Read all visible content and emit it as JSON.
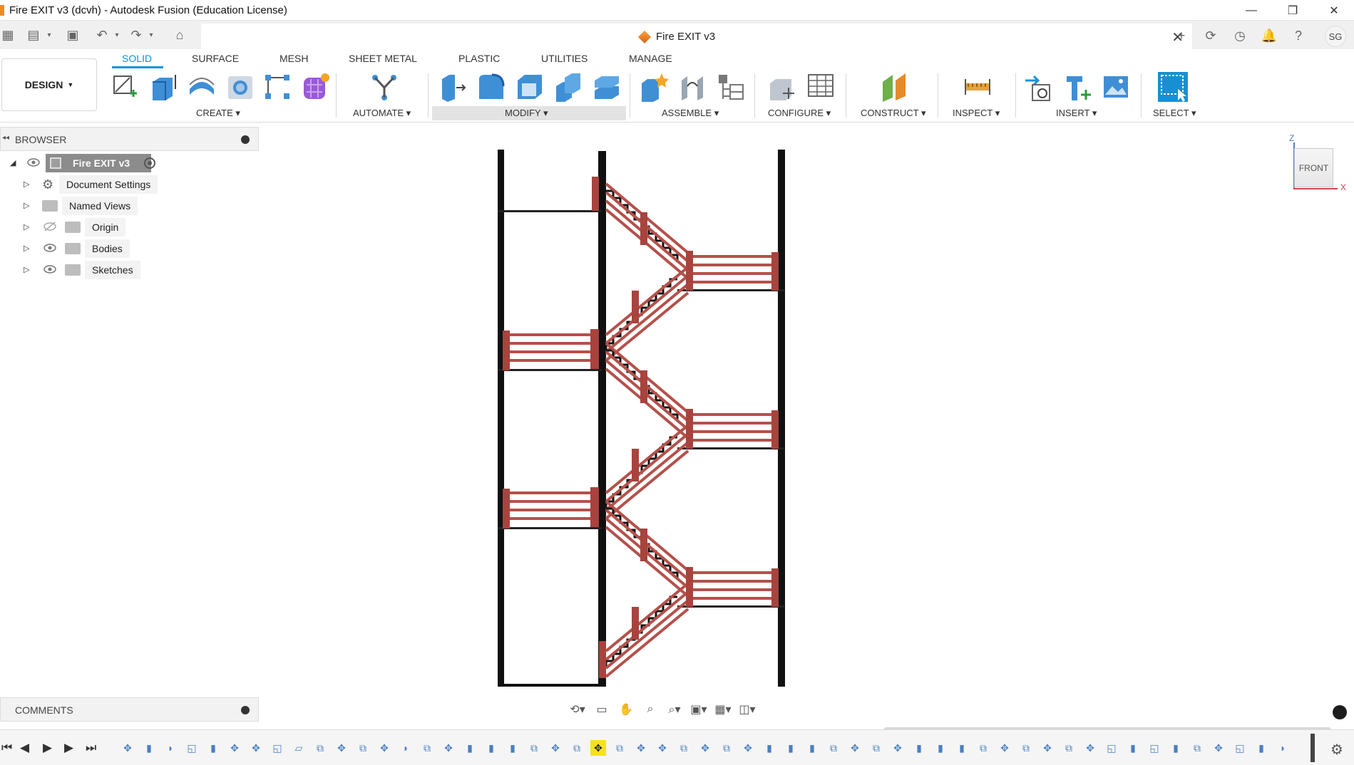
{
  "window": {
    "title": "Fire EXIT v3 (dcvh) - Autodesk Fusion (Education License)",
    "minimize_icon": "minimize-icon",
    "restore_icon": "restore-icon",
    "close_icon": "close-icon"
  },
  "tabbar": {
    "document_tab": "Fire EXIT v3",
    "user_initials": "SG"
  },
  "ribbon": {
    "workspace": "DESIGN",
    "tabs": [
      "SOLID",
      "SURFACE",
      "MESH",
      "SHEET METAL",
      "PLASTIC",
      "UTILITIES",
      "MANAGE"
    ],
    "active_tab": "SOLID",
    "groups": {
      "create": "CREATE",
      "automate": "AUTOMATE",
      "modify": "MODIFY",
      "assemble": "ASSEMBLE",
      "configure": "CONFIGURE",
      "construct": "CONSTRUCT",
      "inspect": "INSPECT",
      "insert": "INSERT",
      "select": "SELECT"
    },
    "accent": "#0696d7"
  },
  "browser": {
    "title": "BROWSER",
    "root": "Fire EXIT v3",
    "items": [
      {
        "label": "Document Settings",
        "icon": "gear-icon"
      },
      {
        "label": "Named Views",
        "icon": "folder-icon"
      },
      {
        "label": "Origin",
        "icon": "folder-icon"
      },
      {
        "label": "Bodies",
        "icon": "folder-icon"
      },
      {
        "label": "Sketches",
        "icon": "folder-icon"
      }
    ]
  },
  "comments": {
    "title": "COMMENTS"
  },
  "viewcube": {
    "face": "FRONT",
    "axis_z": "Z",
    "axis_x": "X"
  },
  "model": {
    "railing_color": "#b5504a",
    "structure_color": "#111111"
  }
}
